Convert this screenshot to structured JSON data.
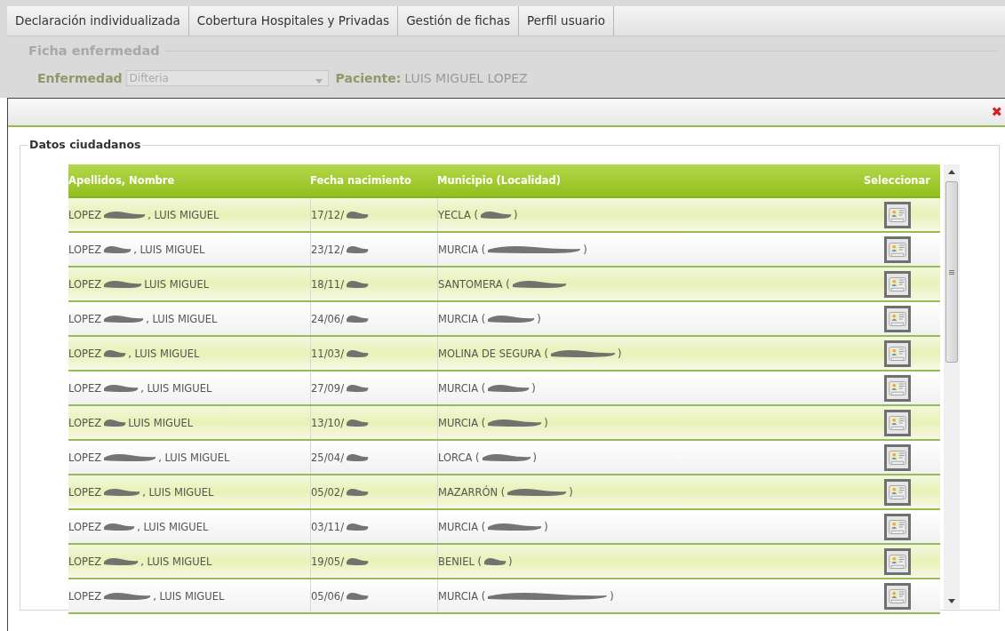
{
  "tabs": [
    {
      "label": "Declaración individualizada"
    },
    {
      "label": "Cobertura Hospitales y Privadas"
    },
    {
      "label": "Gestión de fichas"
    },
    {
      "label": "Perfil usuario"
    }
  ],
  "background_form": {
    "legend": "Ficha enfermedad",
    "disease_label": "Enfermedad",
    "disease_value": "Difteria",
    "patient_label": "Paciente:",
    "patient_value": "LUIS MIGUEL LOPEZ"
  },
  "dialog": {
    "close": "✖",
    "fieldset": "Datos ciudadanos",
    "table": {
      "columns": [
        "Apellidos, Nombre",
        "Fecha nacimiento",
        "Municipio (Localidad)",
        "Seleccionar"
      ],
      "rows": [
        {
          "name_start": "LOPEZ",
          "name_end": ", LUIS MIGUEL",
          "date": "17/12/",
          "town_start": "YECLA (",
          "town_end": ")"
        },
        {
          "name_start": "LOPEZ",
          "name_end": ", LUIS MIGUEL",
          "date": "23/12/",
          "town_start": "MURCIA (",
          "town_end": ")"
        },
        {
          "name_start": "LOPEZ",
          "name_end": "LUIS MIGUEL",
          "date": "18/11/",
          "town_start": "SANTOMERA (",
          "town_end": ""
        },
        {
          "name_start": "LOPEZ",
          "name_end": ", LUIS MIGUEL",
          "date": "24/06/",
          "town_start": "MURCIA (",
          "town_end": ")"
        },
        {
          "name_start": "LOPEZ",
          "name_end": ", LUIS MIGUEL",
          "date": "11/03/",
          "town_start": "MOLINA DE SEGURA (",
          "town_end": ")"
        },
        {
          "name_start": "LOPEZ",
          "name_end": ", LUIS MIGUEL",
          "date": "27/09/",
          "town_start": "MURCIA (",
          "town_end": ")"
        },
        {
          "name_start": "LOPEZ",
          "name_end": "LUIS MIGUEL",
          "date": "13/10/",
          "town_start": "MURCIA (",
          "town_end": ")"
        },
        {
          "name_start": "LOPEZ",
          "name_end": ", LUIS MIGUEL",
          "date": "25/04/",
          "town_start": "LORCA (",
          "town_end": ")"
        },
        {
          "name_start": "LOPEZ",
          "name_end": ", LUIS MIGUEL",
          "date": "05/02/",
          "town_start": "MAZARRÓN (",
          "town_end": ")"
        },
        {
          "name_start": "LOPEZ",
          "name_end": ", LUIS MIGUEL",
          "date": "03/11/",
          "town_start": "MURCIA (",
          "town_end": ")"
        },
        {
          "name_start": "LOPEZ",
          "name_end": ", LUIS MIGUEL",
          "date": "19/05/",
          "town_start": "BENIEL (",
          "town_end": ")"
        },
        {
          "name_start": "LOPEZ",
          "name_end": ", LUIS MIGUEL",
          "date": "05/06/",
          "town_start": "MURCIA (",
          "town_end": ")"
        }
      ]
    }
  }
}
